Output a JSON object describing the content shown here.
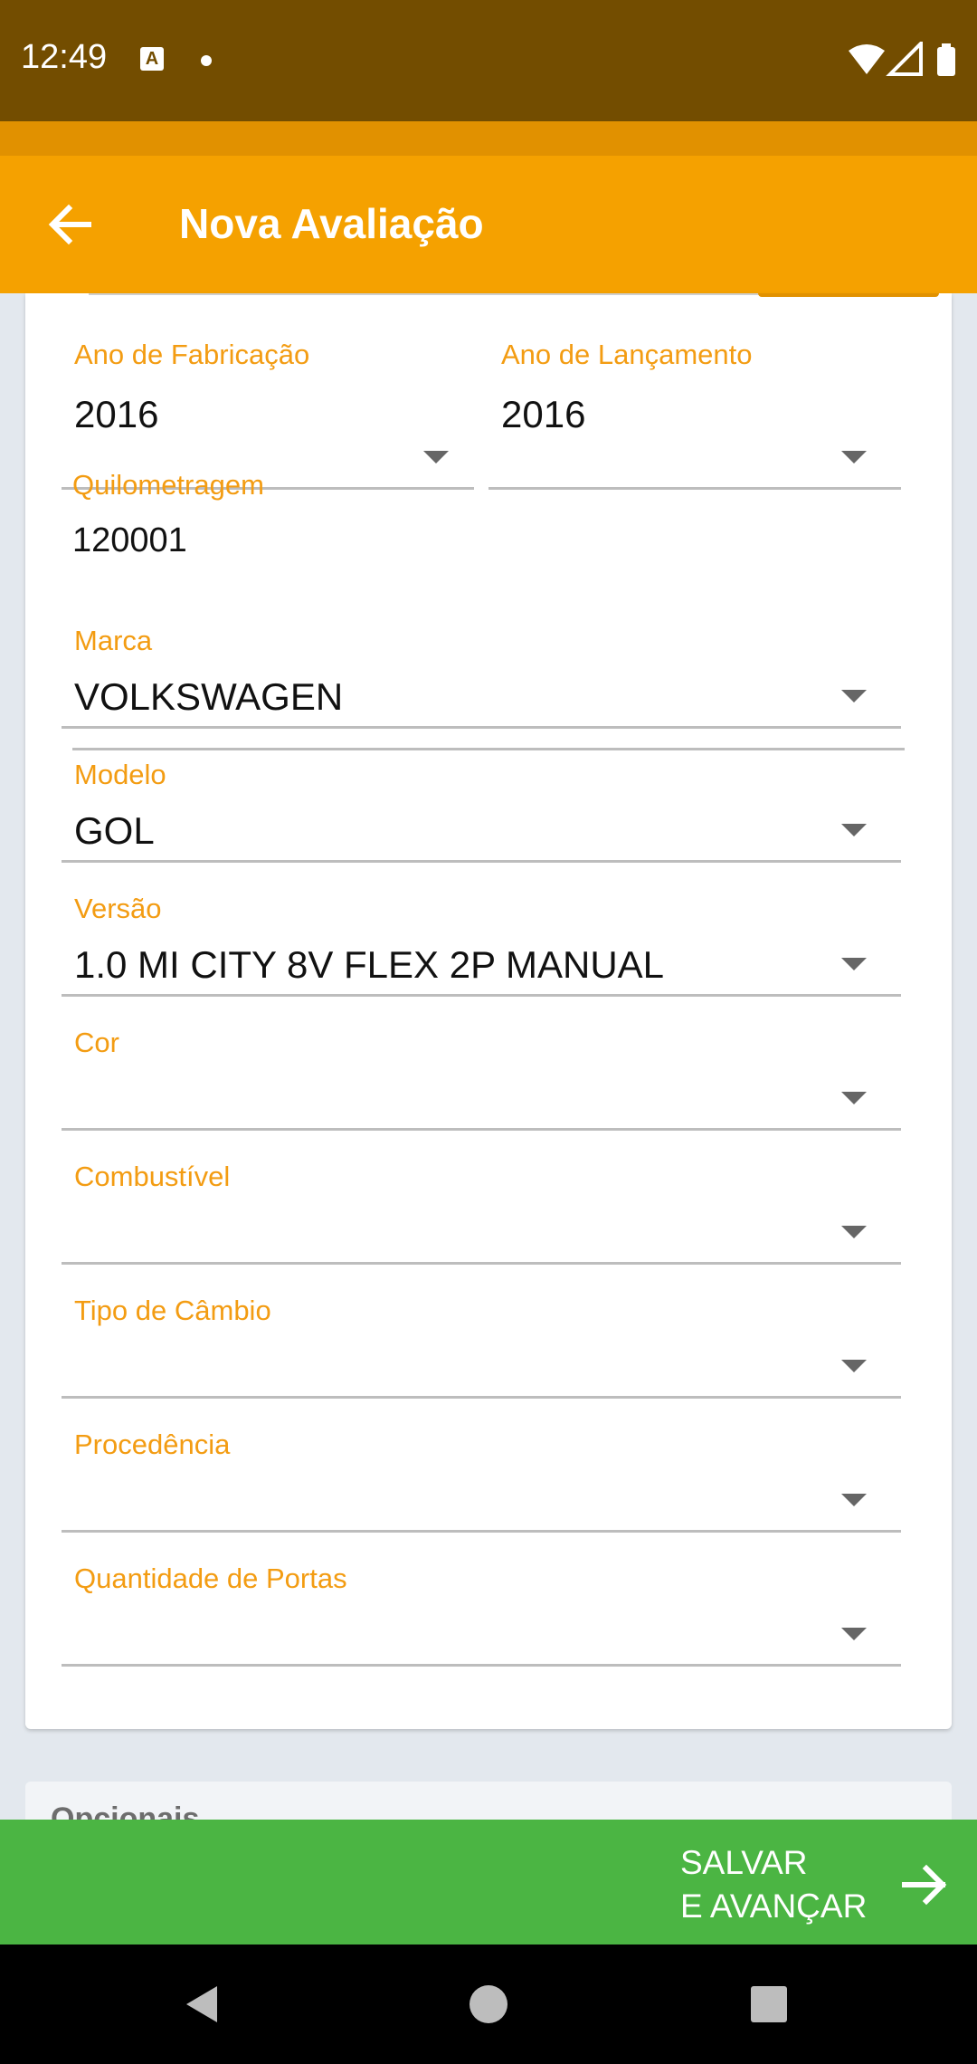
{
  "status_bar": {
    "time": "12:49",
    "notification_glyph": "A"
  },
  "app_bar": {
    "title": "Nova Avaliação"
  },
  "form": {
    "ano_fabricacao": {
      "label": "Ano de Fabricação",
      "value": "2016"
    },
    "ano_lancamento": {
      "label": "Ano de Lançamento",
      "value": "2016"
    },
    "quilometragem": {
      "label": "Quilometragem",
      "value": "120001"
    },
    "marca": {
      "label": "Marca",
      "value": "VOLKSWAGEN"
    },
    "modelo": {
      "label": "Modelo",
      "value": "GOL"
    },
    "versao": {
      "label": "Versão",
      "value": "1.0 MI CITY 8V FLEX 2P MANUAL"
    },
    "cor": {
      "label": "Cor",
      "value": ""
    },
    "combustivel": {
      "label": "Combustível",
      "value": ""
    },
    "tipo_cambio": {
      "label": "Tipo de Câmbio",
      "value": ""
    },
    "procedencia": {
      "label": "Procedência",
      "value": ""
    },
    "quantidade_portas": {
      "label": "Quantidade de Portas",
      "value": ""
    }
  },
  "opcionais": {
    "title": "Opcionais"
  },
  "save_button": {
    "line1": "SALVAR",
    "line2": "E AVANÇAR"
  },
  "colors": {
    "status_bar": "#734d00",
    "app_bar": "#f5a100",
    "label": "#f39c12",
    "save_bar": "#4bb543"
  }
}
